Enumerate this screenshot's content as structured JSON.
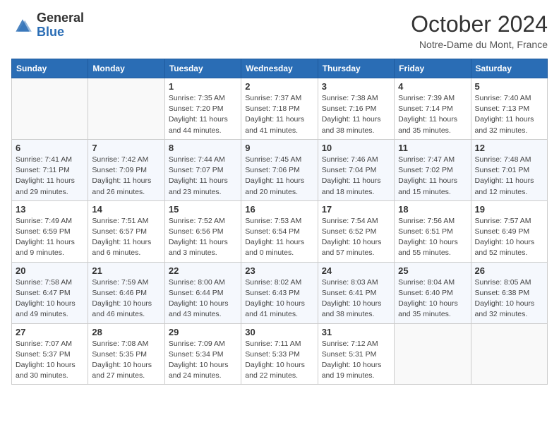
{
  "header": {
    "logo_general": "General",
    "logo_blue": "Blue",
    "month_title": "October 2024",
    "subtitle": "Notre-Dame du Mont, France"
  },
  "weekdays": [
    "Sunday",
    "Monday",
    "Tuesday",
    "Wednesday",
    "Thursday",
    "Friday",
    "Saturday"
  ],
  "weeks": [
    [
      {
        "day": "",
        "info": ""
      },
      {
        "day": "",
        "info": ""
      },
      {
        "day": "1",
        "info": "Sunrise: 7:35 AM\nSunset: 7:20 PM\nDaylight: 11 hours and 44 minutes."
      },
      {
        "day": "2",
        "info": "Sunrise: 7:37 AM\nSunset: 7:18 PM\nDaylight: 11 hours and 41 minutes."
      },
      {
        "day": "3",
        "info": "Sunrise: 7:38 AM\nSunset: 7:16 PM\nDaylight: 11 hours and 38 minutes."
      },
      {
        "day": "4",
        "info": "Sunrise: 7:39 AM\nSunset: 7:14 PM\nDaylight: 11 hours and 35 minutes."
      },
      {
        "day": "5",
        "info": "Sunrise: 7:40 AM\nSunset: 7:13 PM\nDaylight: 11 hours and 32 minutes."
      }
    ],
    [
      {
        "day": "6",
        "info": "Sunrise: 7:41 AM\nSunset: 7:11 PM\nDaylight: 11 hours and 29 minutes."
      },
      {
        "day": "7",
        "info": "Sunrise: 7:42 AM\nSunset: 7:09 PM\nDaylight: 11 hours and 26 minutes."
      },
      {
        "day": "8",
        "info": "Sunrise: 7:44 AM\nSunset: 7:07 PM\nDaylight: 11 hours and 23 minutes."
      },
      {
        "day": "9",
        "info": "Sunrise: 7:45 AM\nSunset: 7:06 PM\nDaylight: 11 hours and 20 minutes."
      },
      {
        "day": "10",
        "info": "Sunrise: 7:46 AM\nSunset: 7:04 PM\nDaylight: 11 hours and 18 minutes."
      },
      {
        "day": "11",
        "info": "Sunrise: 7:47 AM\nSunset: 7:02 PM\nDaylight: 11 hours and 15 minutes."
      },
      {
        "day": "12",
        "info": "Sunrise: 7:48 AM\nSunset: 7:01 PM\nDaylight: 11 hours and 12 minutes."
      }
    ],
    [
      {
        "day": "13",
        "info": "Sunrise: 7:49 AM\nSunset: 6:59 PM\nDaylight: 11 hours and 9 minutes."
      },
      {
        "day": "14",
        "info": "Sunrise: 7:51 AM\nSunset: 6:57 PM\nDaylight: 11 hours and 6 minutes."
      },
      {
        "day": "15",
        "info": "Sunrise: 7:52 AM\nSunset: 6:56 PM\nDaylight: 11 hours and 3 minutes."
      },
      {
        "day": "16",
        "info": "Sunrise: 7:53 AM\nSunset: 6:54 PM\nDaylight: 11 hours and 0 minutes."
      },
      {
        "day": "17",
        "info": "Sunrise: 7:54 AM\nSunset: 6:52 PM\nDaylight: 10 hours and 57 minutes."
      },
      {
        "day": "18",
        "info": "Sunrise: 7:56 AM\nSunset: 6:51 PM\nDaylight: 10 hours and 55 minutes."
      },
      {
        "day": "19",
        "info": "Sunrise: 7:57 AM\nSunset: 6:49 PM\nDaylight: 10 hours and 52 minutes."
      }
    ],
    [
      {
        "day": "20",
        "info": "Sunrise: 7:58 AM\nSunset: 6:47 PM\nDaylight: 10 hours and 49 minutes."
      },
      {
        "day": "21",
        "info": "Sunrise: 7:59 AM\nSunset: 6:46 PM\nDaylight: 10 hours and 46 minutes."
      },
      {
        "day": "22",
        "info": "Sunrise: 8:00 AM\nSunset: 6:44 PM\nDaylight: 10 hours and 43 minutes."
      },
      {
        "day": "23",
        "info": "Sunrise: 8:02 AM\nSunset: 6:43 PM\nDaylight: 10 hours and 41 minutes."
      },
      {
        "day": "24",
        "info": "Sunrise: 8:03 AM\nSunset: 6:41 PM\nDaylight: 10 hours and 38 minutes."
      },
      {
        "day": "25",
        "info": "Sunrise: 8:04 AM\nSunset: 6:40 PM\nDaylight: 10 hours and 35 minutes."
      },
      {
        "day": "26",
        "info": "Sunrise: 8:05 AM\nSunset: 6:38 PM\nDaylight: 10 hours and 32 minutes."
      }
    ],
    [
      {
        "day": "27",
        "info": "Sunrise: 7:07 AM\nSunset: 5:37 PM\nDaylight: 10 hours and 30 minutes."
      },
      {
        "day": "28",
        "info": "Sunrise: 7:08 AM\nSunset: 5:35 PM\nDaylight: 10 hours and 27 minutes."
      },
      {
        "day": "29",
        "info": "Sunrise: 7:09 AM\nSunset: 5:34 PM\nDaylight: 10 hours and 24 minutes."
      },
      {
        "day": "30",
        "info": "Sunrise: 7:11 AM\nSunset: 5:33 PM\nDaylight: 10 hours and 22 minutes."
      },
      {
        "day": "31",
        "info": "Sunrise: 7:12 AM\nSunset: 5:31 PM\nDaylight: 10 hours and 19 minutes."
      },
      {
        "day": "",
        "info": ""
      },
      {
        "day": "",
        "info": ""
      }
    ]
  ]
}
